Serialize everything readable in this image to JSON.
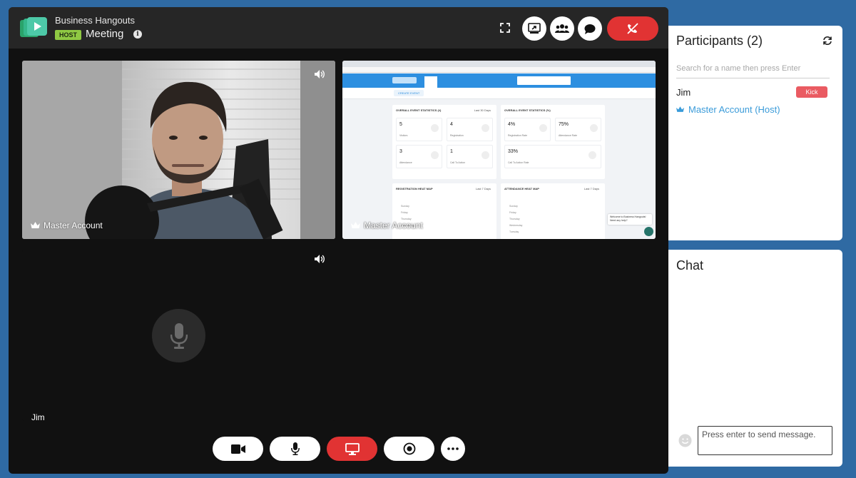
{
  "app": {
    "brand": "Business Hangouts",
    "host_badge": "HOST",
    "meeting_title": "Meeting",
    "info_icon": "i"
  },
  "icons": {
    "logo": "business-hangouts-logo",
    "expand": "expand-icon",
    "share_screen": "share-screen-icon",
    "participants": "people-icon",
    "chat": "chat-bubble-icon",
    "leave": "phone-hangup-icon",
    "volume": "volume-icon",
    "crown": "crown-icon",
    "mic": "microphone-icon",
    "camera": "video-camera-icon",
    "screen": "monitor-icon",
    "record": "record-icon",
    "more": "more-dots-icon",
    "refresh": "refresh-icon",
    "emoji": "emoji-icon"
  },
  "tiles": [
    {
      "label": "Master Account"
    },
    {
      "label": "Master Account"
    },
    {
      "label": "Jim"
    }
  ],
  "participants": {
    "title": "Participants (2)",
    "search_placeholder": "Search for a name then press Enter",
    "list": [
      {
        "name": "Jim",
        "action": "Kick"
      },
      {
        "name": "Master Account (Host)"
      }
    ]
  },
  "chat": {
    "title": "Chat",
    "input_placeholder": "Press enter to send message."
  },
  "shared_screen": {
    "stats_left_title": "OVERALL EVENT STATISTICS (#)",
    "stats_right_title": "OVERALL EVENT STATISTICS (%)",
    "filter": "Last 30 Days",
    "create_event": "CREATE EVENT",
    "left_cards": [
      {
        "value": "5",
        "label": "Visitors"
      },
      {
        "value": "4",
        "label": "Registration"
      },
      {
        "value": "3",
        "label": "Attendance"
      },
      {
        "value": "1",
        "label": "Call To Action"
      }
    ],
    "right_cards": [
      {
        "value": "4%",
        "label": "Registration Rate"
      },
      {
        "value": "75%",
        "label": "Attendance Rate"
      },
      {
        "value": "33%",
        "label": "Call To Action Rate"
      }
    ],
    "heatmap_left": "REGISTRATION HEAT MAP",
    "heatmap_right": "ATTENDANCE HEAT MAP",
    "heatmap_filter": "Last 7 Days",
    "chat_popup": "Welcome to Business Hangouts! Need any help?",
    "days": [
      "Sunday",
      "Friday",
      "Thursday",
      "Wednesday",
      "Tuesday",
      "Monday"
    ]
  },
  "colors": {
    "background": "#2f6aa3",
    "host_badge": "#8fc843",
    "leave": "#e13333",
    "screen_share_active": "#e13333",
    "host_link": "#3a9bd9",
    "kick": "#ea5b62"
  }
}
